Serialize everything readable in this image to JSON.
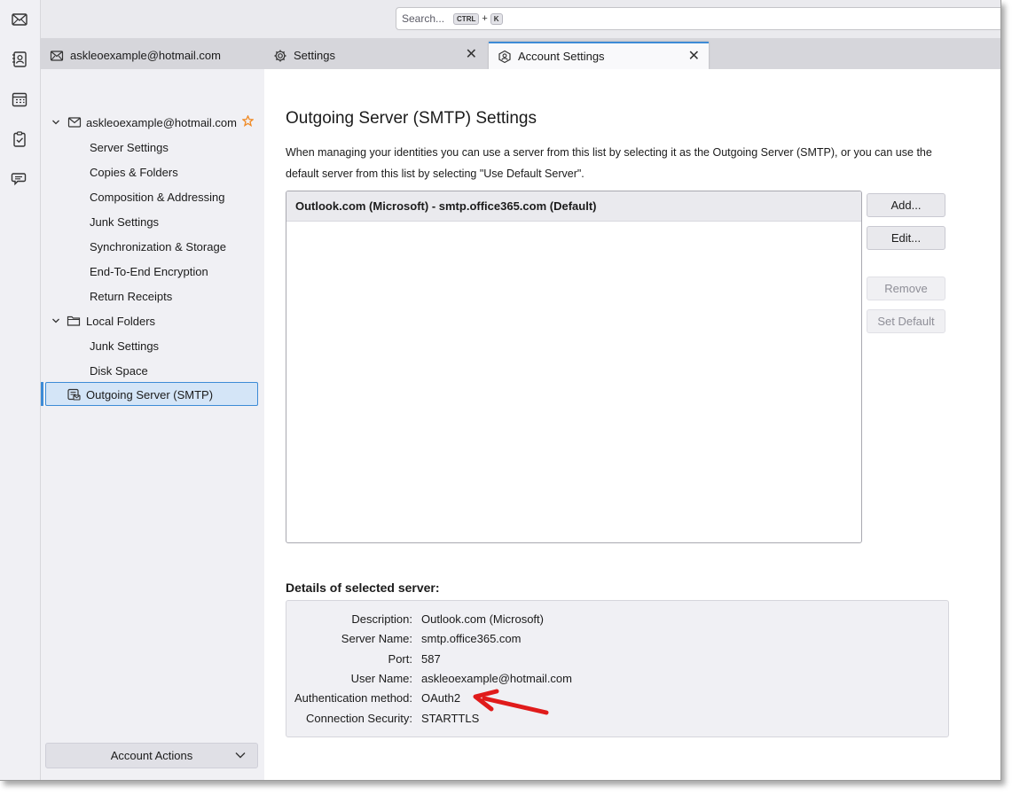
{
  "search": {
    "placeholder": "Search...",
    "key1": "CTRL",
    "plus": "+",
    "key2": "K"
  },
  "tabs": [
    {
      "label": "askleoexample@hotmail.com",
      "icon": "mail-icon"
    },
    {
      "label": "Settings",
      "icon": "gear-icon"
    },
    {
      "label": "Account Settings",
      "icon": "account-settings-icon",
      "close": "✕"
    }
  ],
  "settings_tab_close": "✕",
  "sidebar": {
    "account": "askleoexample@hotmail.com",
    "account_items": [
      "Server Settings",
      "Copies & Folders",
      "Composition & Addressing",
      "Junk Settings",
      "Synchronization & Storage",
      "End-To-End Encryption",
      "Return Receipts"
    ],
    "local_folders": "Local Folders",
    "local_items": [
      "Junk Settings",
      "Disk Space"
    ],
    "outgoing": "Outgoing Server (SMTP)",
    "account_actions": "Account Actions"
  },
  "main": {
    "title": "Outgoing Server (SMTP) Settings",
    "description": "When managing your identities you can use a server from this list by selecting it as the Outgoing Server (SMTP), or you can use the default server from this list by selecting \"Use Default Server\".",
    "servers": [
      "Outlook.com (Microsoft) - smtp.office365.com (Default)"
    ],
    "buttons": {
      "add": "Add...",
      "edit": "Edit...",
      "remove": "Remove",
      "set_default": "Set Default"
    },
    "details_heading": "Details of selected server:",
    "details": {
      "description_label": "Description:",
      "description": "Outlook.com (Microsoft)",
      "server_label": "Server Name:",
      "server": "smtp.office365.com",
      "port_label": "Port:",
      "port": "587",
      "user_label": "User Name:",
      "user": "askleoexample@hotmail.com",
      "auth_label": "Authentication method:",
      "auth": "OAuth2",
      "security_label": "Connection Security:",
      "security": "STARTTLS"
    }
  },
  "colors": {
    "accent": "#3d8bd6",
    "annotation_arrow": "#e01b1b",
    "account_star": "#f08a24"
  }
}
